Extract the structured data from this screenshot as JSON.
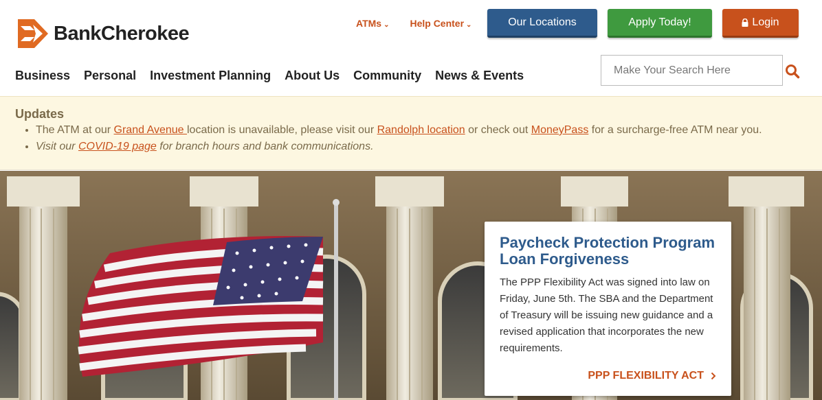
{
  "brand": {
    "name": "BankCherokee",
    "accent": "#c8511c",
    "blue": "#2e5b8c",
    "green": "#3f9a3f"
  },
  "utility_links": [
    {
      "label": "ATMs",
      "icon": "chevron-down-icon"
    },
    {
      "label": "Help Center",
      "icon": "chevron-down-icon"
    }
  ],
  "buttons": {
    "locations": "Our Locations",
    "apply": "Apply Today!",
    "login": "Login",
    "login_icon": "lock-icon"
  },
  "nav": [
    "Business",
    "Personal",
    "Investment Planning",
    "About Us",
    "Community",
    "News & Events"
  ],
  "search": {
    "placeholder": "Make Your Search Here",
    "icon": "search-icon"
  },
  "updates": {
    "title": "Updates",
    "item1": {
      "t1": "The ATM at our ",
      "link1": "Grand Avenue ",
      "t2": "location is unavailable, please visit our ",
      "link2": "Randolph location",
      "t3": " or check out ",
      "link3": "MoneyPass",
      "t4": " for a surcharge-free ATM near you."
    },
    "item2": {
      "t1": "Visit our ",
      "link1": "COVID-19 page",
      "t2": " for branch hours and bank communications."
    }
  },
  "card": {
    "title": "Paycheck Protection Program Loan Forgiveness",
    "body": "The PPP Flexibility Act was signed into law on Friday, June 5th. The SBA and the Department of Treasury will be issuing new guidance and a revised application that incorporates the new requirements.",
    "cta": "PPP FLEXIBILITY ACT",
    "cta_icon": "chevron-right-icon"
  }
}
